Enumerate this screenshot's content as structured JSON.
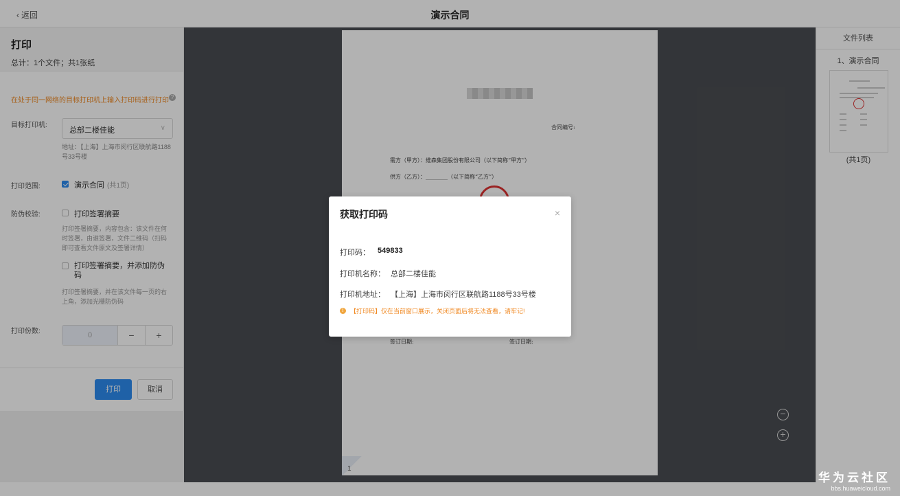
{
  "header": {
    "back_label": "返回",
    "title": "演示合同"
  },
  "left_panel": {
    "heading": "打印",
    "summary": "总计：1个文件；共1张纸",
    "tip": "在处于同一网络的目标打印机上输入打印码进行打印",
    "printer_label": "目标打印机:",
    "printer_value": "总部二楼佳能",
    "printer_address": "地址：【上海】上海市闵行区联航路1188号33号楼",
    "range_label": "打印范围:",
    "range_item": "演示合同",
    "range_pages": "(共1页)",
    "anti_fake_label": "防伪校验:",
    "option1_label": "打印签署摘要",
    "option1_desc": "打印签署摘要，内容包含：该文件在何时签署，由谁签署，文件二维码（扫码即可查看文件原文及签署详情）",
    "option2_label": "打印签署摘要，并添加防伪码",
    "option2_desc": "打印签署摘要，并在该文件每一页的右上角，添加光栅防伪码",
    "copies_label": "打印份数:",
    "copies_value": "0",
    "minus": "−",
    "plus": "+",
    "print_button": "打印",
    "cancel_button": "取消"
  },
  "document": {
    "contract_no": "合同编号:",
    "party_a": "需方（甲方）：维森集团股份有限公司（以下简称“甲方”）",
    "party_b": "供方（乙方）：________（以下简称“乙方”）",
    "sign_date_a": "签订日期:",
    "sign_date_b": "签订日期:",
    "page_number": "1"
  },
  "zoom": {
    "out_icon": "−",
    "in_icon": "+"
  },
  "file_list": {
    "title": "文件列表",
    "file_name": "1、演示合同",
    "pages": "(共1页)"
  },
  "modal": {
    "title": "获取打印码",
    "close": "×",
    "code_label": "打印码：",
    "code_value": "549833",
    "printer_name_label": "打印机名称：",
    "printer_name_value": "总部二楼佳能",
    "printer_addr_label": "打印机地址：",
    "printer_addr_value": "【上海】上海市闵行区联航路1188号33号楼",
    "warning": "【打印码】仅在当前窗口展示，关闭页面后将无法查看，请牢记!"
  },
  "watermark": {
    "brand": "华为云社区",
    "url": "bbs.huaweicloud.com"
  },
  "colors": {
    "primary": "#2d8cf0",
    "warning": "#f08a24",
    "preview_bg": "#4a4d52"
  }
}
